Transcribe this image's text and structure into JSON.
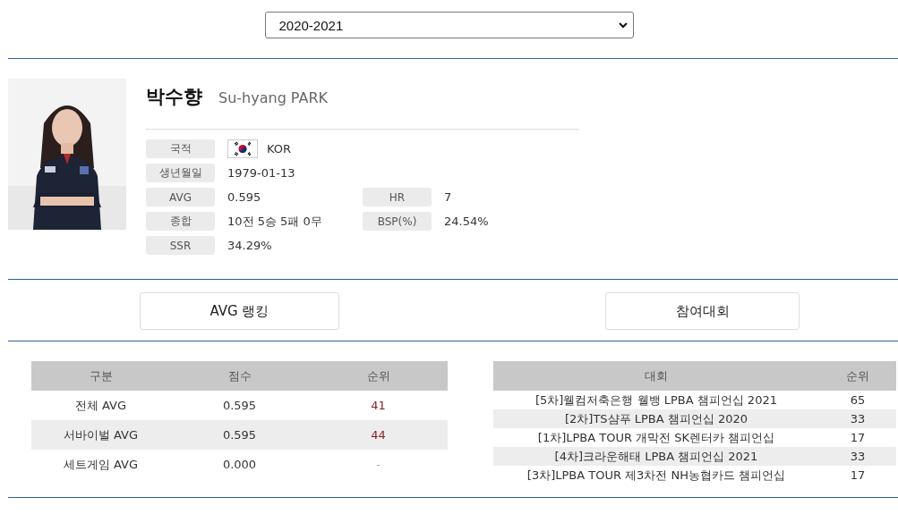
{
  "season_select": {
    "value": "2020-2021"
  },
  "player": {
    "name_ko": "박수향",
    "name_en": "Su-hyang PARK",
    "info": [
      {
        "label": "국적",
        "value": "KOR",
        "kind": "flag"
      },
      {
        "label": "생년월일",
        "value": "1979-01-13",
        "kind": "text"
      },
      {
        "label": "AVG",
        "value": "0.595",
        "kind": "text",
        "side_label": "HR",
        "side_value": "7"
      },
      {
        "label": "종합",
        "value": "10전 5승 5패 0무",
        "kind": "text",
        "side_label": "BSP(%)",
        "side_value": "24.54%"
      },
      {
        "label": "SSR",
        "value": "34.29%",
        "kind": "text"
      }
    ]
  },
  "section_buttons": [
    "AVG 랭킹",
    "참여대회"
  ],
  "avg_table": {
    "columns": [
      "구분",
      "점수",
      "순위"
    ],
    "rows": [
      {
        "cells": [
          "전체 AVG",
          "0.595",
          "41"
        ],
        "ranked": true
      },
      {
        "cells": [
          "서바이벌 AVG",
          "0.595",
          "44"
        ],
        "ranked": true
      },
      {
        "cells": [
          "세트게임 AVG",
          "0.000",
          "-"
        ],
        "ranked": false
      }
    ]
  },
  "tournament_table": {
    "columns": [
      "대회",
      "순위"
    ],
    "rows": [
      [
        "[5차]웰컴저축은행 웰뱅 LPBA 챔피언십 2021",
        "65"
      ],
      [
        "[2차]TS샴푸 LPBA 챔피언십 2020",
        "33"
      ],
      [
        "[1차]LPBA TOUR 개막전 SK렌터카 챔피언십",
        "17"
      ],
      [
        "[4차]크라운해태 LPBA 챔피언십 2021",
        "33"
      ],
      [
        "[3차]LPBA TOUR 제3차전 NH농협카드 챔피언십",
        "17"
      ]
    ]
  }
}
